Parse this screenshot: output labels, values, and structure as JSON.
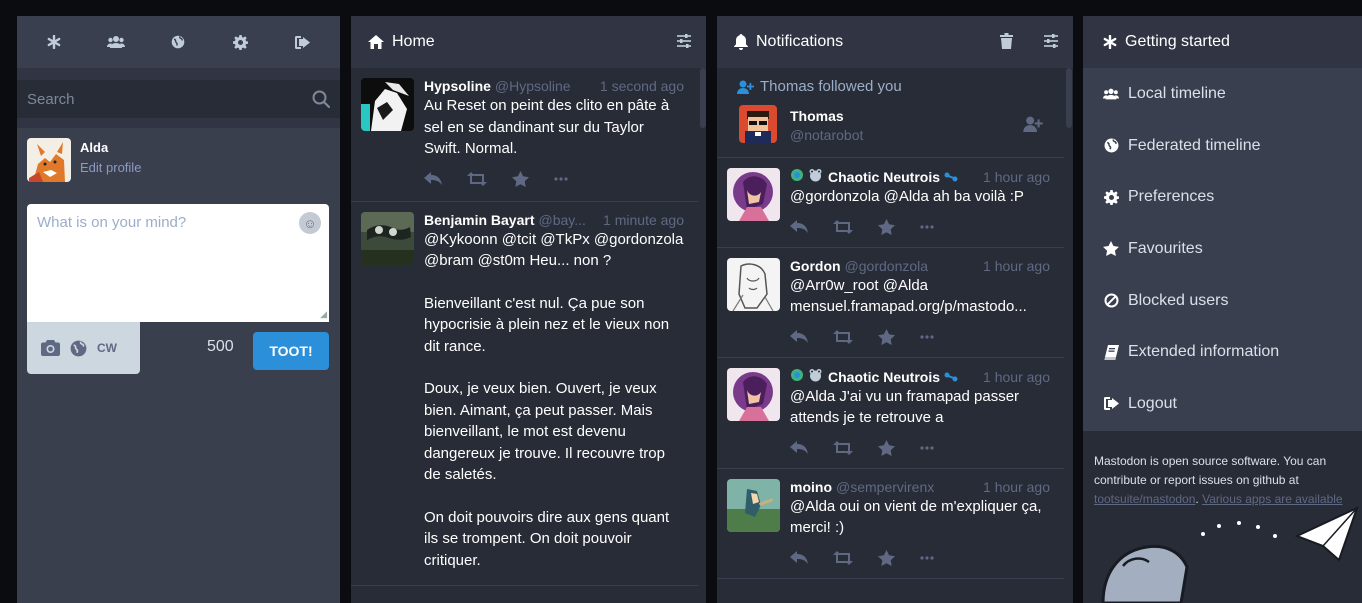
{
  "nav": {
    "icons": [
      "asterisk-icon",
      "people-icon",
      "globe-icon",
      "gear-icon",
      "logout-icon"
    ],
    "search_placeholder": "Search",
    "user_name": "Alda",
    "edit_profile": "Edit profile"
  },
  "compose": {
    "placeholder": "What is on your mind?",
    "cw_label": "CW",
    "char_count": "500",
    "toot_label": "TOOT!"
  },
  "home": {
    "title": "Home",
    "statuses": [
      {
        "display_name": "Hypsoline",
        "acct": "@Hypsoline",
        "time": "1 second ago",
        "paragraphs": [
          "Au Reset on peint des clito en pâte à sel en se dandinant sur du Taylor Swift. Normal."
        ]
      },
      {
        "display_name": "Benjamin Bayart",
        "acct": "@bay...",
        "time": "1 minute ago",
        "paragraphs": [
          "@Kykoonn @tcit @TkPx @gordonzola @bram @st0m Heu... non ?",
          "Bienveillant c'est nul. Ça pue son hypocrisie à plein nez et le vieux non dit rance.",
          "Doux, je veux bien. Ouvert, je veux bien. Aimant, ça peut passer. Mais bienveillant, le mot est devenu dangereux je trouve. Il recouvre trop de saletés.",
          "On doit pouvoirs dire aux gens quant ils se trompent. On doit pouvoir critiquer."
        ]
      }
    ]
  },
  "notifications": {
    "title": "Notifications",
    "follow": {
      "text": "Thomas followed you",
      "name": "Thomas",
      "acct": "@notarobot"
    },
    "statuses": [
      {
        "display_name": "Chaotic Neutrois",
        "acct": "",
        "time": "1 hour ago",
        "text": "@gordonzola @Alda ah ba voilà :P"
      },
      {
        "display_name": "Gordon",
        "acct": "@gordonzola",
        "time": "1 hour ago",
        "text": "@Arr0w_root @Alda mensuel.framapad.org/p/mastodo..."
      },
      {
        "display_name": "Chaotic Neutrois",
        "acct": "",
        "time": "1 hour ago",
        "text": "@Alda J'ai vu un framapad passer attends je te retrouve a"
      },
      {
        "display_name": "moino",
        "acct": "@sempervirenx",
        "time": "1 hour ago",
        "text": "@Alda oui on vient de m'expliquer ça, merci! :)"
      }
    ]
  },
  "getting_started": {
    "title": "Getting started",
    "items": [
      {
        "label": "Local timeline",
        "icon": "people-icon"
      },
      {
        "label": "Federated timeline",
        "icon": "globe-icon"
      },
      {
        "label": "Preferences",
        "icon": "gear-icon"
      },
      {
        "label": "Favourites",
        "icon": "star-icon"
      },
      {
        "label": "Blocked users",
        "icon": "ban-icon"
      },
      {
        "label": "Extended information",
        "icon": "book-icon"
      },
      {
        "label": "Logout",
        "icon": "logout-icon"
      }
    ],
    "footer_line1": "Mastodon is open source software. You can",
    "footer_line2": "contribute or report issues on github at",
    "footer_link1": "tootsuite/mastodon",
    "footer_sep": ". ",
    "footer_link2": "Various apps are available"
  },
  "colors": {
    "accent": "#2b90d9",
    "column_bg": "#282c37",
    "header_bg": "#313543",
    "muted": "#606984"
  }
}
